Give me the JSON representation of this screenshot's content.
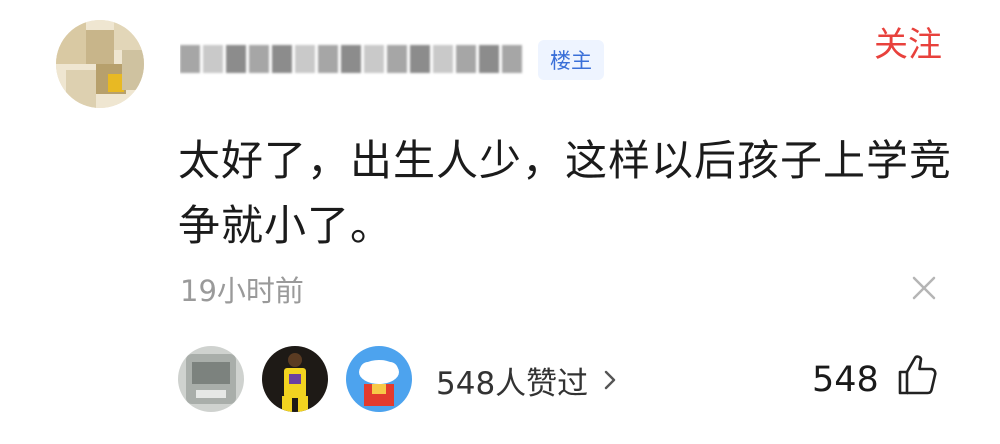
{
  "author": {
    "badge": "楼主"
  },
  "follow_label": "关注",
  "comment_text": "太好了，出生人少，这样以后孩子上学竞争就小了。",
  "timestamp": "19小时前",
  "likers": {
    "summary": "548人赞过"
  },
  "like_count": "548",
  "colors": {
    "follow": "#e8413c",
    "badge_text": "#3a6fd8",
    "badge_bg": "#eef4ff",
    "meta_text": "#9a9a9a"
  },
  "icons": [
    "close-icon",
    "chevron-right-icon",
    "thumbs-up-icon"
  ]
}
